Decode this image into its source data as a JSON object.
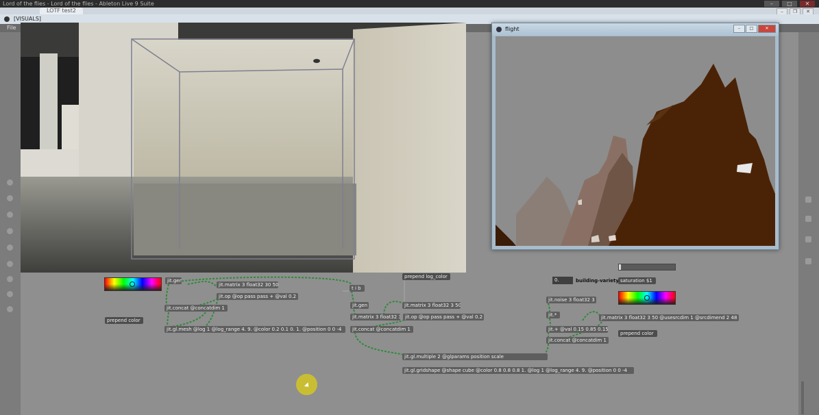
{
  "app": {
    "title": "Lord of the flies - Lord of the flies - Ableton Live 9 Suite",
    "tab": "LOTF test2",
    "window_title": "[VISUALS]",
    "menu_file": "File"
  },
  "flight": {
    "title": "flight"
  },
  "objects": {
    "jit_gen_1": "jit.gen",
    "jit_matrix_1": "jit.matrix 3 float32 30 50",
    "jit_op_1": "jit.op @op pass pass + @val 0.2",
    "t_i_b": "t i b",
    "prepend_log_color": "prepend log_color",
    "jit_concat_1": "jit.concat @concatdim 1",
    "prepend_color_1": "prepend color",
    "jit_gl_mesh": "jit.gl.mesh @log 1 @log_range 4. 9. @color 0.2 0.1 0. 1. @position 0 0 -4",
    "jit_gen_2": "jit.gen",
    "jit_matrix_2": "jit.matrix 3 float32 3 50",
    "jit_matrix_3": "jit.matrix 3 float32 3",
    "jit_op_2": "jit.op @op pass pass + @val 0.2",
    "jit_concat_2": "jit.concat @concatdim 1",
    "num_value": "0.",
    "building_variety": "building-variety",
    "saturation": "saturation $1",
    "jit_noise": "jit.noise 3 float32 3",
    "jit_star": "jit.*",
    "jit_matrix_4": "jit.matrix 3 float32 3 50 @usesrcdim 1 @srcdimend 2 48",
    "jit_plus": "jit.+ @val 0.15 0.85 0.15",
    "jit_concat_3": "jit.concat @concatdim 1",
    "prepend_color_2": "prepend color",
    "jit_gl_multiple": "jit.gl.multiple 2 @glparams position scale",
    "jit_gl_gridshape": "jit.gl.gridshape @shape cube @color 0.8 0.8 0.8 1. @log 1 @log_range 4. 9. @position 0 0 -4"
  },
  "colors": {
    "patch_cord": "#2f8a3a",
    "terrain": "#4a2307",
    "accent_cursor": "#dccd14"
  }
}
